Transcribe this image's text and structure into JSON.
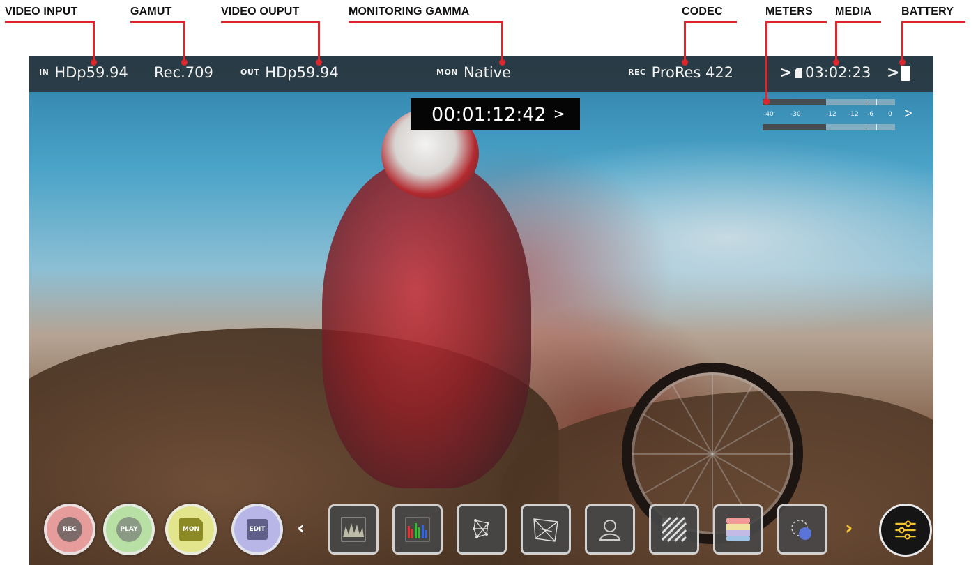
{
  "callouts": {
    "video_input": "VIDEO INPUT",
    "gamut": "GAMUT",
    "video_output": "VIDEO OUPUT",
    "monitoring_gamma": "MONITORING GAMMA",
    "codec": "CODEC",
    "meters": "METERS",
    "media": "MEDIA",
    "battery": "BATTERY"
  },
  "status_bar": {
    "input_tag": "IN",
    "input_value": "HDp59.94",
    "gamut_value": "Rec.709",
    "output_tag": "OUT",
    "output_value": "HDp59.94",
    "mon_tag": "MON",
    "mon_value": "Native",
    "rec_tag": "REC",
    "codec_value": "ProRes 422",
    "media_remaining": "03:02:23",
    "chevron": ">"
  },
  "timecode": {
    "value": "00:01:12:42",
    "chevron": ">"
  },
  "audio_meters": {
    "scale": [
      "-40",
      "-30",
      "-12",
      "-12",
      "-6",
      "0"
    ],
    "levels": [
      0.48,
      0.48
    ],
    "chevron": ">"
  },
  "mode_buttons": {
    "rec": "REC",
    "play": "PLAY",
    "mon": "MON",
    "edit": "EDIT"
  },
  "toolbar": {
    "prev": "‹",
    "next": "›"
  },
  "colors": {
    "callout_red": "#e0262d",
    "status_bar_bg": "#2c3034",
    "rec_ring": "#e59c9a",
    "play_ring": "#b8e0a4",
    "mon_ring": "#e3e58d",
    "edit_ring": "#b7b6e6",
    "chevron_yellow": "#f2c230"
  },
  "tool_icons": [
    "waveform-icon",
    "rgb-parade-icon",
    "vectorscope-small-icon",
    "vectorscope-large-icon",
    "false-color-icon",
    "zebra-icon",
    "color-bars-icon",
    "focus-peaking-icon"
  ]
}
